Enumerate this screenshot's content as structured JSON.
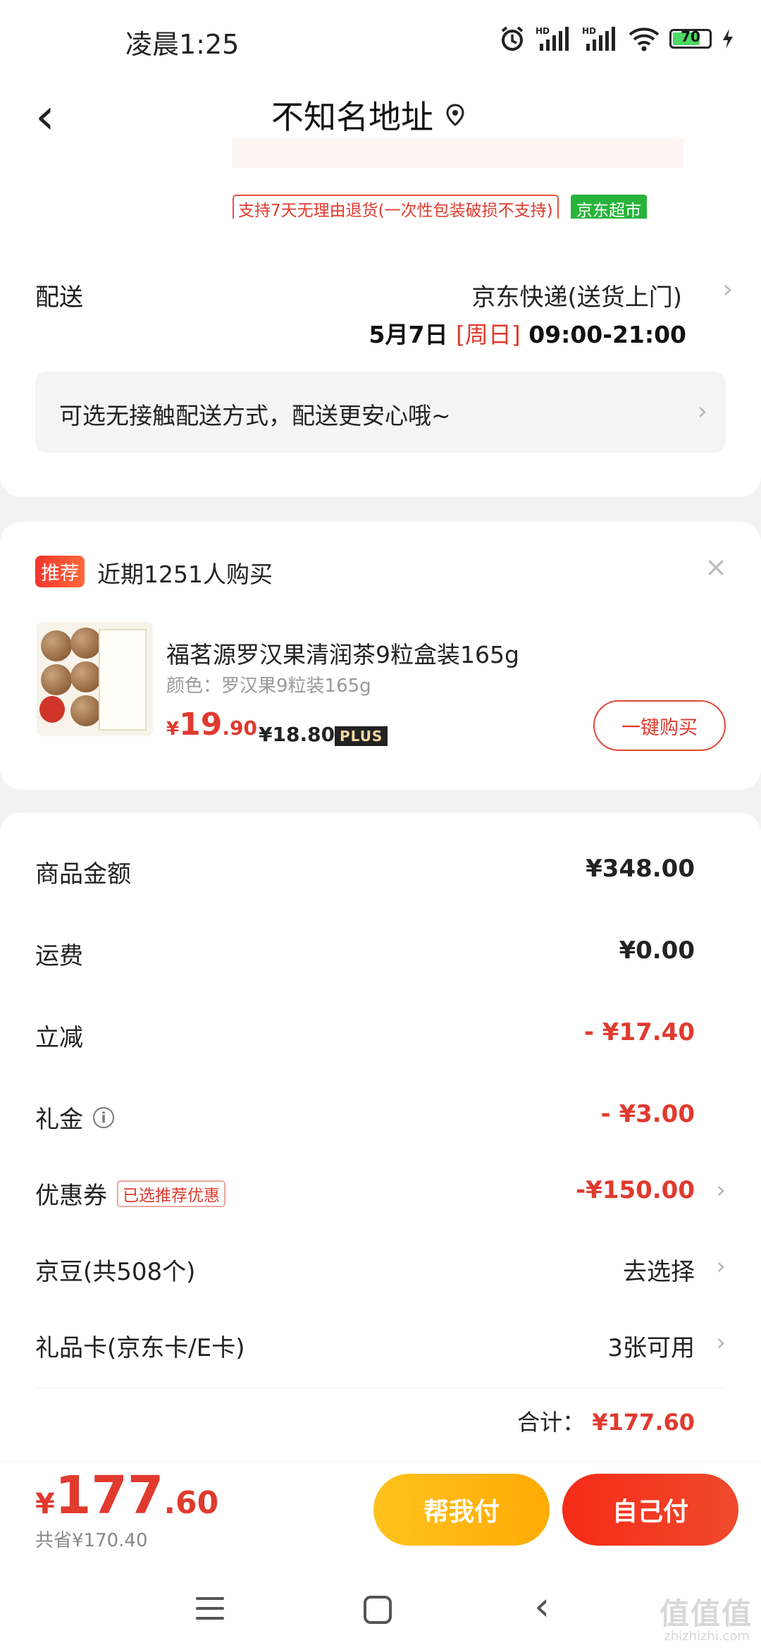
{
  "status_bar": {
    "time": "凌晨1:25",
    "battery": "70"
  },
  "header": {
    "back_label": "‹",
    "title": "不知名地址"
  },
  "policy": {
    "return_text": "支持7天无理由退货(一次性包装破损不支持)",
    "store_tag": "京东超市"
  },
  "delivery": {
    "label": "配送",
    "carrier": "京东快递(送货上门)",
    "date": "5月7日",
    "weekday": "[周日]",
    "time_window": "09:00-21:00",
    "contactless_tip": "可选无接触配送方式，配送更安心哦~"
  },
  "recommend": {
    "tag": "推荐",
    "text": "近期1251人购买",
    "close": "×",
    "product": {
      "name": "福茗源罗汉果清润茶9粒盒装165g",
      "color": "颜色：罗汉果9粒装165g",
      "price_symbol": "¥",
      "price_int": "19",
      "price_dec": ".90",
      "plus_price": "¥18.80",
      "plus_label": "PLUS",
      "buy_button": "一键购买"
    }
  },
  "summary": {
    "rows": [
      {
        "label": "商品金额",
        "value": "¥348.00"
      },
      {
        "label": "运费",
        "value": "¥0.00"
      },
      {
        "label": "立减",
        "value": "- ¥17.40"
      },
      {
        "label": "礼金",
        "value": "- ¥3.00"
      },
      {
        "label": "优惠券",
        "tag": "已选推荐优惠",
        "value": "-¥150.00"
      },
      {
        "label": "京豆(共508个)",
        "value": "去选择"
      },
      {
        "label": "礼品卡(京东卡/E卡)",
        "value": "3张可用"
      }
    ],
    "total_label": "合计：",
    "total_value": "¥177.60"
  },
  "pay": {
    "symbol": "¥",
    "amount_int": "177",
    "amount_dec": ".60",
    "saved": "共省¥170.40",
    "help_pay": "帮我付",
    "self_pay": "自己付"
  },
  "watermark": {
    "main": "值值值",
    "sub": "zhizhizhi.com"
  },
  "colors": {
    "accent_red": "#e03a2e",
    "help_yellow": "#ffb812",
    "jd_green": "#28b33b"
  }
}
